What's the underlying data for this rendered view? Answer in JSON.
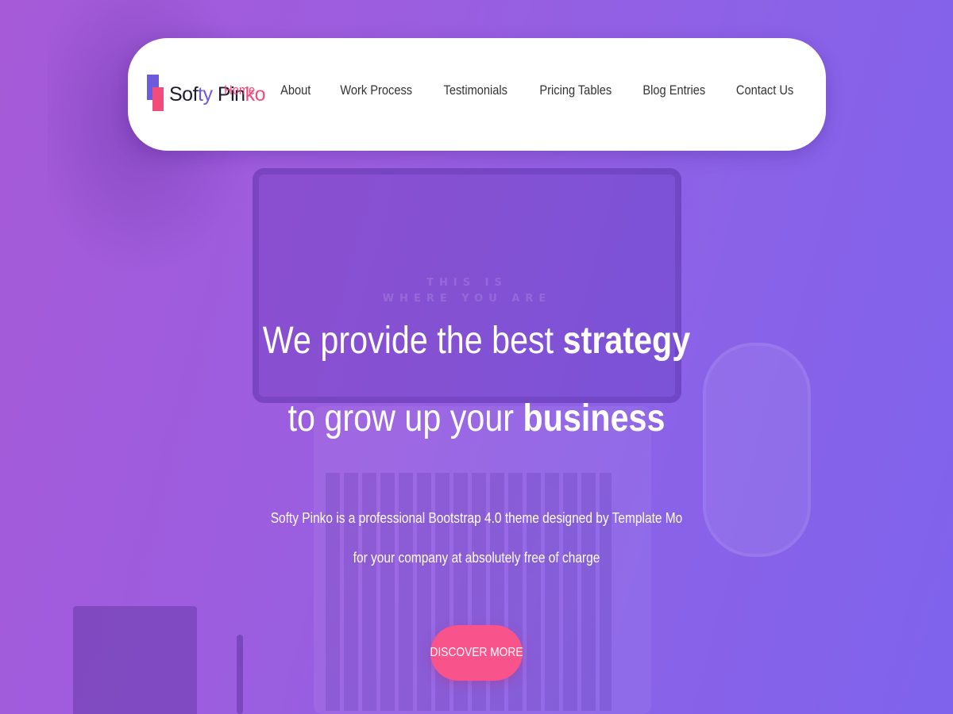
{
  "brand": {
    "part1": "Sof",
    "part2": "ty",
    "part3": " Pin",
    "part4": "ko",
    "colors": {
      "blue": "#6d5bdc",
      "pink": "#f24c7d"
    }
  },
  "nav": {
    "items": [
      {
        "label": "Home",
        "active": true
      },
      {
        "label": "About",
        "active": false
      },
      {
        "label": "Work Process",
        "active": false
      },
      {
        "label": "Testimonials",
        "active": false
      },
      {
        "label": "Pricing Tables",
        "active": false
      },
      {
        "label": "Blog Entries",
        "active": false
      },
      {
        "label": "Contact Us",
        "active": false
      }
    ]
  },
  "background": {
    "screen_line1": "THIS IS",
    "screen_line2": "WHERE YOU ARE"
  },
  "hero": {
    "line1_prefix": "We provide the best ",
    "line1_bold": "strategy",
    "line2_prefix": "to grow up your ",
    "line2_bold": "business",
    "sub1": "Softy Pinko is a professional Bootstrap 4.0 theme designed by Template Mo",
    "sub2": "for your company at absolutely free of charge",
    "cta_label": "DISCOVER MORE"
  },
  "colors": {
    "gradient_start": "#a65ad8",
    "gradient_end": "#7f63ec",
    "accent_pink": "#f8538a",
    "nav_active": "#f24c7d"
  }
}
